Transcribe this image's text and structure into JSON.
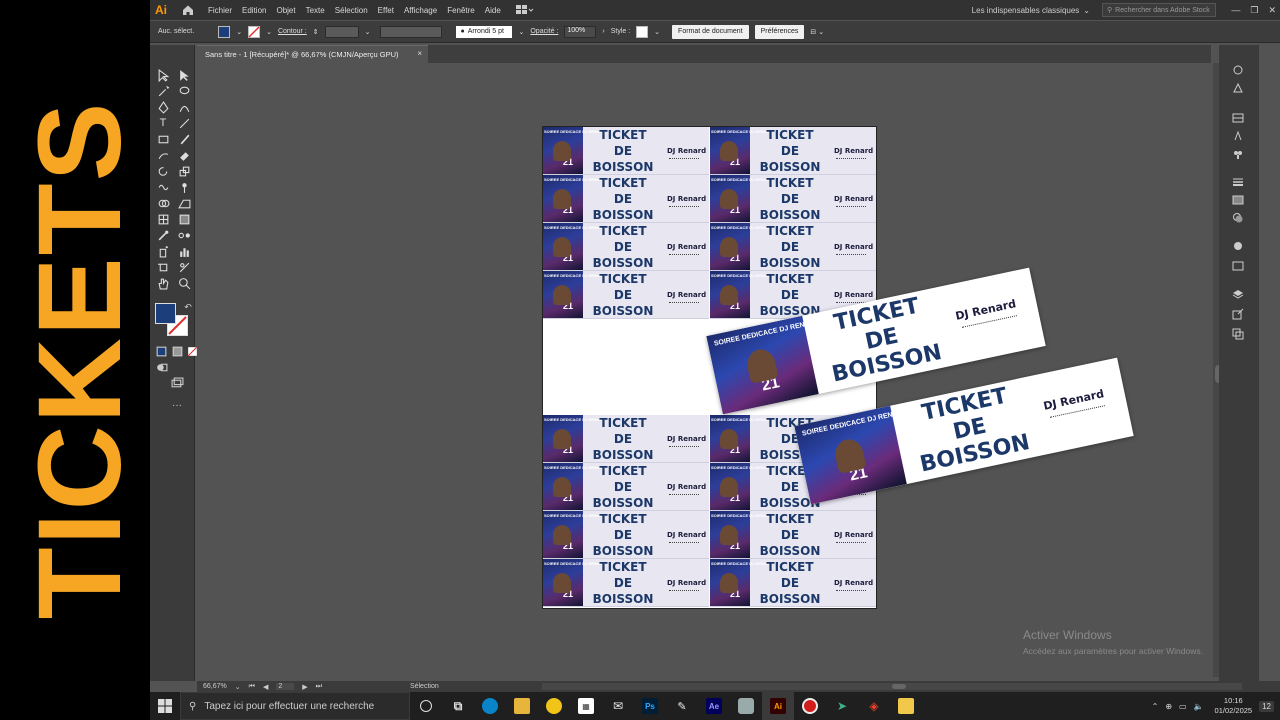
{
  "overlay": {
    "title": "TICKETS",
    "accent": "#f6a623"
  },
  "app": {
    "logo": "Ai",
    "menu": [
      "Fichier",
      "Edition",
      "Objet",
      "Texte",
      "Sélection",
      "Effet",
      "Affichage",
      "Fenêtre",
      "Aide"
    ],
    "workspace": "Les indispensables classiques",
    "search_placeholder": "Rechercher dans Adobe Stock"
  },
  "controlbar": {
    "selection_label": "Auc. sélect.",
    "stroke_label": "Contour :",
    "stroke_value": "",
    "brush_label": "Arrondi 5 pt",
    "opacity_label": "Opacité :",
    "opacity_value": "100%",
    "style_label": "Style :",
    "doc_format_btn": "Format de document",
    "prefs_btn": "Préférences",
    "fill_color": "#1c3f7b"
  },
  "document": {
    "tab_title": "Sans titre - 1 [Récupéré]* @ 66,67% (CMJN/Aperçu GPU)",
    "close": "×"
  },
  "ticket": {
    "line1": "TICKET",
    "line2": "DE",
    "line3": "BOISSON",
    "dj": "DJ Renard",
    "flyer_text": "SOIREE DEDICACE DJ RENARD",
    "flyer_num": "21",
    "title_color": "#1c3868"
  },
  "status": {
    "zoom": "66,67%",
    "page": "2",
    "tool": "Sélection"
  },
  "activate": {
    "title": "Activer Windows",
    "subtitle": "Accédez aux paramètres pour activer Windows."
  },
  "taskbar": {
    "search_placeholder": "Tapez ici pour effectuer une recherche",
    "time": "10:16",
    "date": "01/02/2025",
    "notifications": "12"
  }
}
